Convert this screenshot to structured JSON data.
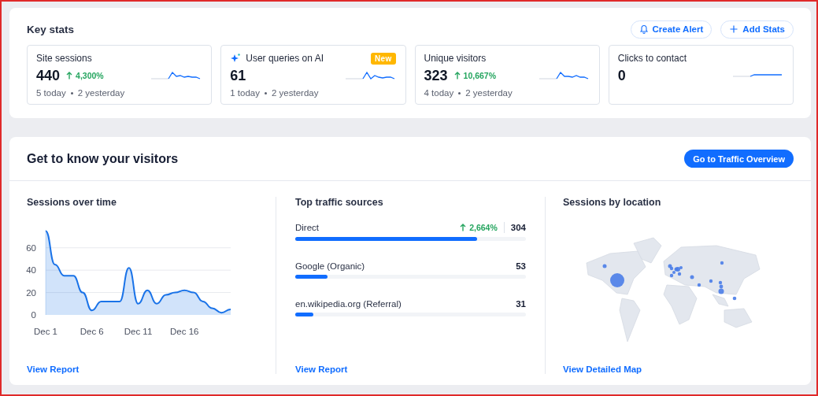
{
  "key_stats": {
    "title": "Key stats",
    "buttons": [
      {
        "kind": "alert",
        "label": "Create Alert"
      },
      {
        "kind": "add",
        "label": "Add Stats"
      }
    ],
    "stats": [
      {
        "label": "Site sessions",
        "ai": false,
        "value": "440",
        "change": "4,300%",
        "today": "5 today",
        "yesterday": "2 yesterday"
      },
      {
        "label": "User queries on AI",
        "ai": true,
        "badge": "New",
        "value": "61",
        "today": "1 today",
        "yesterday": "2 yesterday"
      },
      {
        "label": "Unique visitors",
        "ai": false,
        "value": "323",
        "change": "10,667%",
        "today": "4 today",
        "yesterday": "2 yesterday"
      },
      {
        "label": "Clicks to contact",
        "ai": false,
        "value": "0"
      }
    ]
  },
  "visitors": {
    "title": "Get to know your visitors",
    "button": "Go to Traffic Overview",
    "sessions_over_time": {
      "title": "Sessions over time",
      "link": "View Report",
      "chart_data": {
        "type": "area",
        "categories": [
          "Dec 1",
          null,
          null,
          null,
          null,
          "Dec 6",
          null,
          null,
          null,
          null,
          "Dec 11",
          null,
          null,
          null,
          null,
          "Dec 16",
          null,
          null,
          null,
          null,
          null
        ],
        "grid": true,
        "ylim": [
          0,
          76
        ],
        "yticks": [
          0,
          20,
          40,
          60
        ],
        "series": [
          {
            "color": "#1a73e8",
            "values": [
              75,
              45,
              35,
              35,
              20,
              4,
              12,
              12,
              12,
              42,
              10,
              22,
              10,
              18,
              20,
              22,
              20,
              12,
              6,
              2,
              5
            ]
          }
        ]
      }
    },
    "top_traffic_sources": {
      "title": "Top traffic sources",
      "link": "View Report",
      "sources": [
        {
          "name": "Direct",
          "change": "2,664%",
          "count": "304",
          "level": 0.79
        },
        {
          "name": "Google (Organic)",
          "count": "53",
          "level": 0.14
        },
        {
          "name": "en.wikipedia.org (Referral)",
          "count": "31",
          "level": 0.08
        }
      ]
    },
    "sessions_by_location": {
      "title": "Sessions by location",
      "link": "View Detailed Map"
    }
  }
}
